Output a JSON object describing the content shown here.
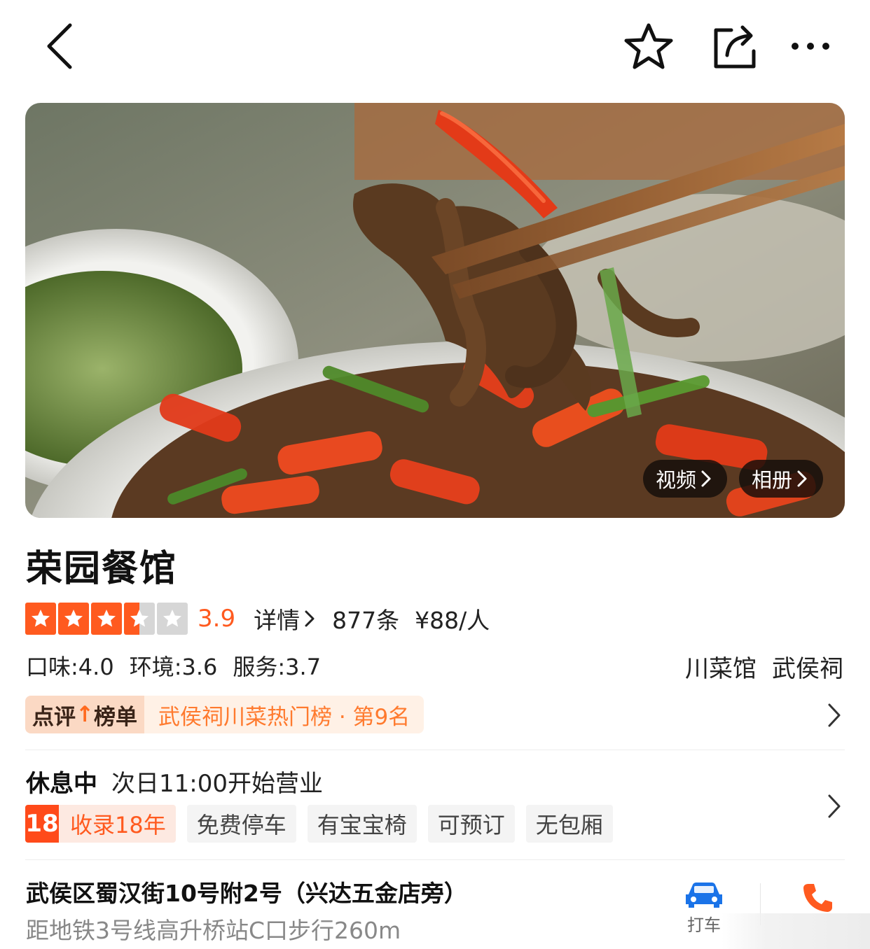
{
  "header": {
    "icons": [
      "back-arrow-icon",
      "star-outline-icon",
      "share-icon",
      "more-dots-icon"
    ]
  },
  "hero": {
    "video_label": "视频",
    "album_label": "相册"
  },
  "shop": {
    "name": "荣园餐馆",
    "rating": 3.5,
    "score": "3.9",
    "detail_label": "详情",
    "review_count": "877条",
    "price": "¥88/人",
    "sub_scores": {
      "taste": "口味:4.0",
      "environment": "环境:3.6",
      "service": "服务:3.7"
    },
    "category": "川菜馆",
    "area": "武侯祠"
  },
  "ranking": {
    "badge_left": "点评",
    "badge_right": "榜单",
    "text": "武侯祠川菜热门榜 · 第9名"
  },
  "hours": {
    "status": "休息中",
    "next_open": "次日11:00开始营业"
  },
  "features": {
    "years_number": "18",
    "years_label": "收录18年",
    "chips": [
      "免费停车",
      "有宝宝椅",
      "可预订",
      "无包厢"
    ]
  },
  "location": {
    "address": "武侯区蜀汉街10号附2号（兴达五金店旁）",
    "metro": "距地铁3号线高升桥站C口步行260m",
    "taxi_label": "打车"
  },
  "colors": {
    "accent": "#ff5a1f",
    "star_fill": "#ff5a1f",
    "star_empty": "#d6d6d6",
    "rank_bg": "#fff1e6",
    "taxi_icon": "#1a73e8",
    "phone_icon": "#ff5a1f"
  }
}
